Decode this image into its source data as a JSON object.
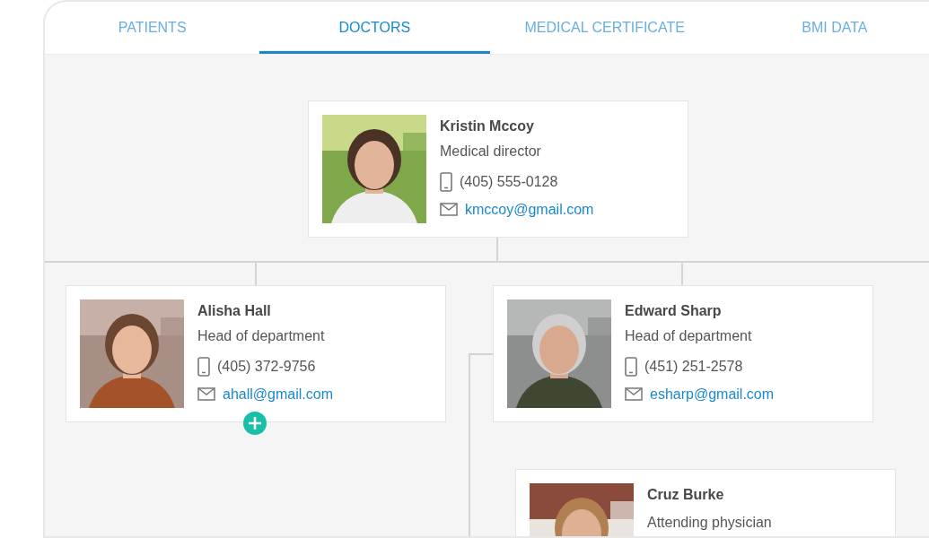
{
  "tabs": [
    {
      "label": "PATIENTS",
      "selected": false
    },
    {
      "label": "DOCTORS",
      "selected": true
    },
    {
      "label": "MEDICAL CERTIFICATE",
      "selected": false
    },
    {
      "label": "BMI DATA",
      "selected": false
    }
  ],
  "org_chart": {
    "root": {
      "name": "Kristin Mccoy",
      "role": "Medical director",
      "phone": "(405) 555-0128",
      "email": "kmccoy@gmail.com",
      "children": [
        {
          "name": "Alisha Hall",
          "role": "Head of department",
          "phone": "(405) 372-9756",
          "email": "ahall@gmail.com"
        },
        {
          "name": "Edward Sharp",
          "role": "Head of department",
          "phone": "(451) 251-2578",
          "email": "esharp@gmail.com",
          "children": [
            {
              "name": "Cruz Burke",
              "role": "Attending physician"
            }
          ]
        }
      ]
    }
  }
}
